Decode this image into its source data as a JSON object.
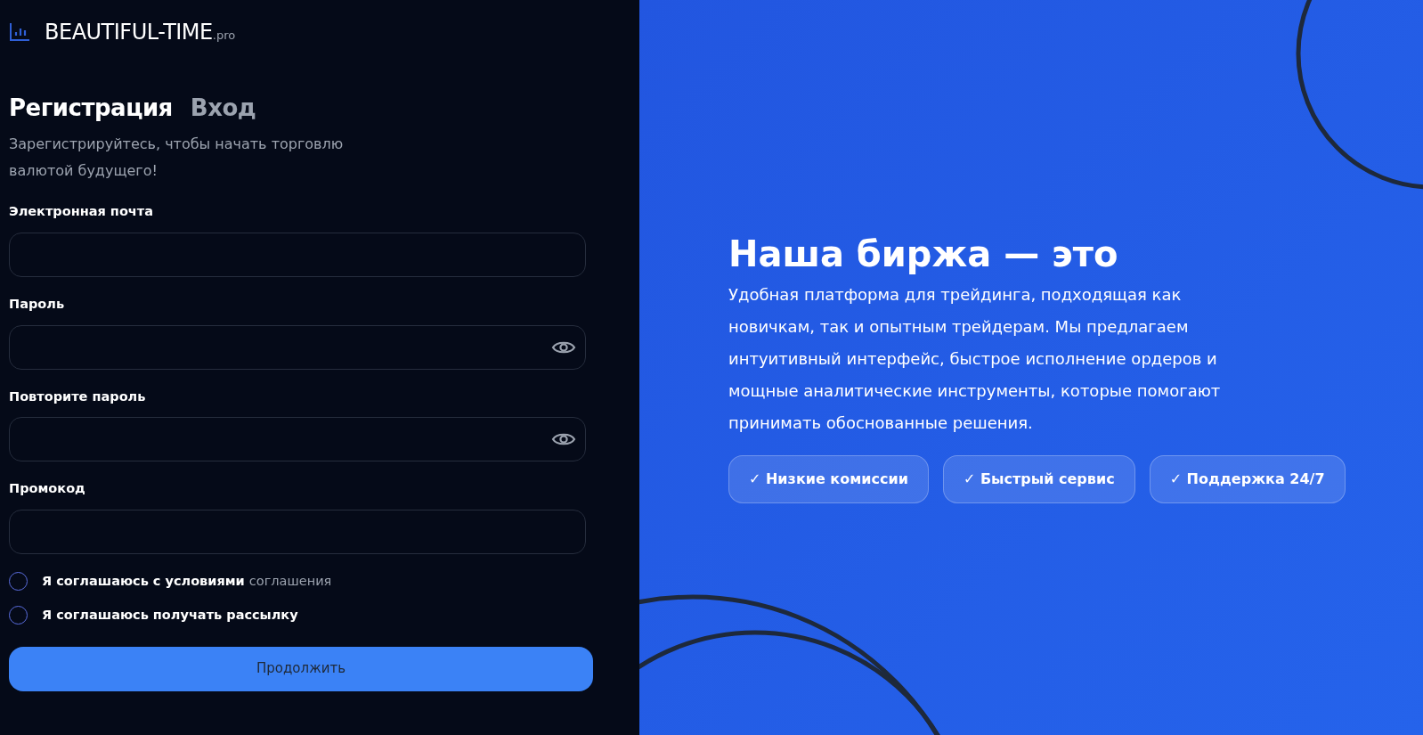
{
  "logo": {
    "name": "BEAUTIFUL-TIME",
    "suffix": ".pro"
  },
  "tabs": [
    {
      "label": "Регистрация",
      "selected": true
    },
    {
      "label": "Вход",
      "selected": false
    }
  ],
  "subtitle": "Зарегистрируйтесь, чтобы начать торговлю валютой будущего!",
  "fields": [
    {
      "label": "Электронная почта",
      "kind": "text"
    },
    {
      "label": "Пароль",
      "kind": "password"
    },
    {
      "label": "Повторите пароль",
      "kind": "password"
    },
    {
      "label": "Промокод",
      "kind": "text"
    }
  ],
  "checkboxes": [
    {
      "text": "Я соглашаюсь с условиями",
      "link": "соглашения",
      "checked": false
    },
    {
      "text": "Я соглашаюсь получать рассылку",
      "checked": false
    }
  ],
  "submit": "Продолжить",
  "promo": {
    "heading": "Наша биржа — это",
    "text": "Удобная платформа для трейдинга, подходящая как новичкам, так и опытным трейдерам. Мы предлагаем интуитивный интерфейс, быстрое исполнение ордеров и мощные аналитические инструменты, которые помогают принимать обоснованные решения.",
    "features": [
      "✓ Низкие комиссии",
      "✓ Быстрый сервис",
      "✓ Поддержка 24/7"
    ]
  }
}
